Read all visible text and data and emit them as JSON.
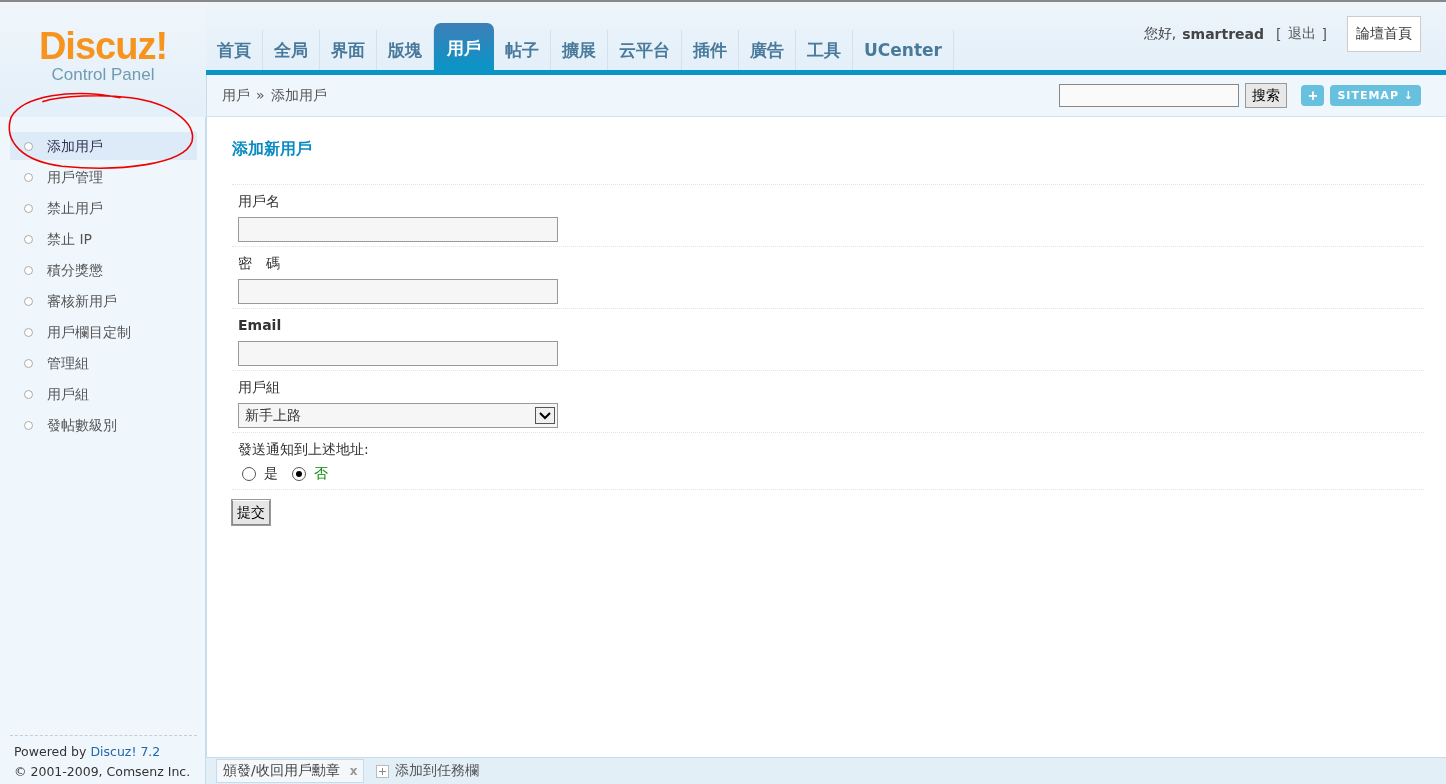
{
  "logo": {
    "name": "Discuz!",
    "subtitle": "Control Panel"
  },
  "nav": [
    {
      "label": "首頁",
      "selected": false
    },
    {
      "label": "全局",
      "selected": false
    },
    {
      "label": "界面",
      "selected": false
    },
    {
      "label": "版塊",
      "selected": false
    },
    {
      "label": "用戶",
      "selected": true
    },
    {
      "label": "帖子",
      "selected": false
    },
    {
      "label": "擴展",
      "selected": false
    },
    {
      "label": "云平台",
      "selected": false
    },
    {
      "label": "插件",
      "selected": false
    },
    {
      "label": "廣告",
      "selected": false
    },
    {
      "label": "工具",
      "selected": false
    },
    {
      "label": "UCenter",
      "selected": false
    }
  ],
  "user": {
    "greeting": "您好,",
    "name": "smartread",
    "logout_open": "[",
    "logout": "退出",
    "logout_close": "]",
    "home": "論壇首頁"
  },
  "breadcrumb": {
    "parent": "用戶",
    "sep": "»",
    "current": "添加用戶"
  },
  "search": {
    "button": "搜索",
    "plus": "+",
    "sitemap": "SITEMAP ↓"
  },
  "sidebar": [
    {
      "label": "添加用戶",
      "selected": true
    },
    {
      "label": "用戶管理",
      "selected": false
    },
    {
      "label": "禁止用戶",
      "selected": false
    },
    {
      "label": "禁止 IP",
      "selected": false
    },
    {
      "label": "積分獎懲",
      "selected": false
    },
    {
      "label": "審核新用戶",
      "selected": false
    },
    {
      "label": "用戶欄目定制",
      "selected": false
    },
    {
      "label": "管理組",
      "selected": false
    },
    {
      "label": "用戶組",
      "selected": false
    },
    {
      "label": "發帖數級別",
      "selected": false
    }
  ],
  "footer": {
    "prefix": "Powered by",
    "link": "Discuz! 7.2",
    "copyright": "© 2001-2009, Comsenz Inc."
  },
  "form": {
    "title": "添加新用戶",
    "fields": [
      {
        "kind": "text",
        "label": "用戶名"
      },
      {
        "kind": "text",
        "label": "密　碼"
      },
      {
        "kind": "text",
        "label": "Email"
      },
      {
        "kind": "select",
        "label": "用戶組",
        "value": "新手上路"
      },
      {
        "kind": "radio",
        "label": "發送通知到上述地址:",
        "options": [
          {
            "label": "是",
            "selected": false
          },
          {
            "label": "否",
            "selected": true
          }
        ]
      }
    ],
    "submit": "提交"
  },
  "taskbar": [
    {
      "kind": "tab",
      "label": "頒發/收回用戶勳章",
      "close": "x"
    },
    {
      "kind": "add",
      "label": "添加到任務欄"
    }
  ]
}
